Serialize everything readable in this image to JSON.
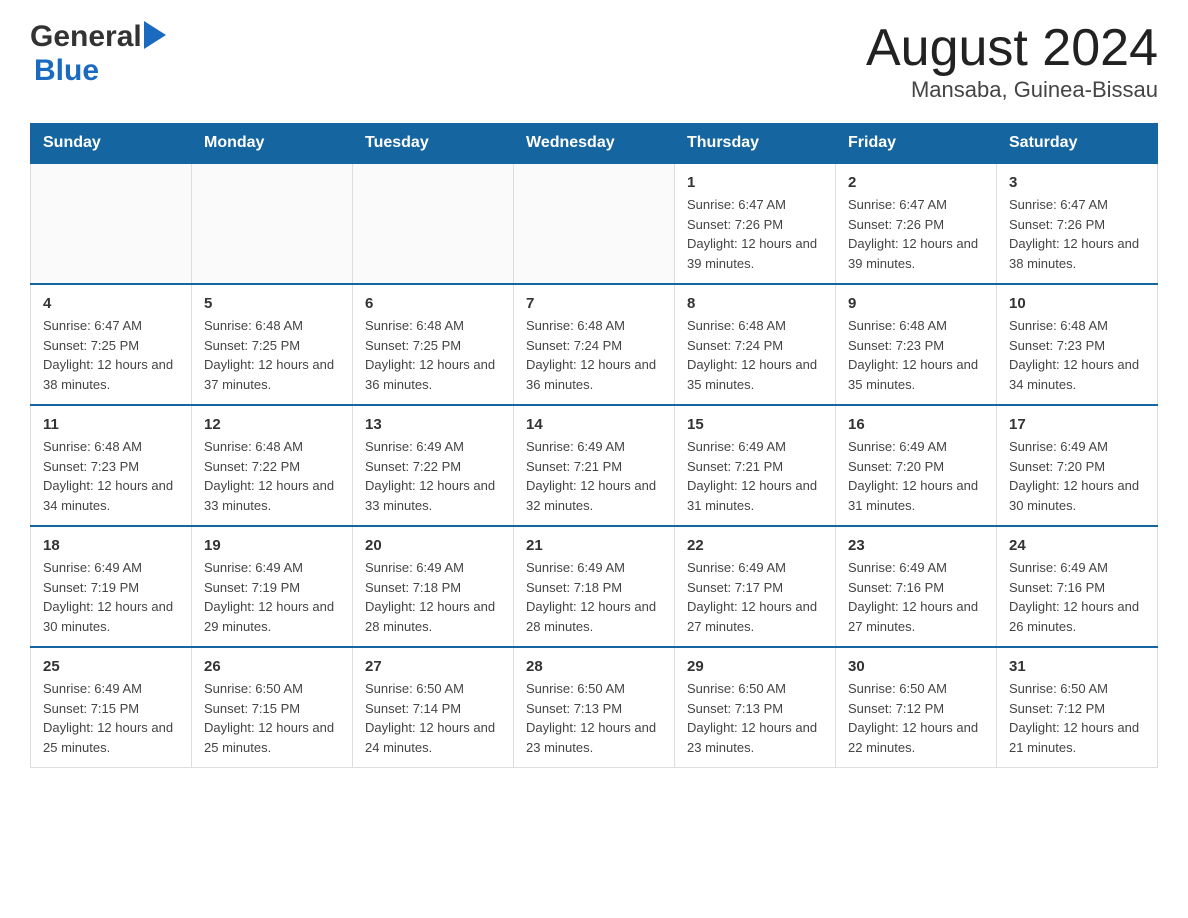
{
  "header": {
    "logo_general": "General",
    "logo_blue": "Blue",
    "title": "August 2024",
    "subtitle": "Mansaba, Guinea-Bissau"
  },
  "days_of_week": [
    "Sunday",
    "Monday",
    "Tuesday",
    "Wednesday",
    "Thursday",
    "Friday",
    "Saturday"
  ],
  "weeks": [
    [
      {
        "num": "",
        "sunrise": "",
        "sunset": "",
        "daylight": ""
      },
      {
        "num": "",
        "sunrise": "",
        "sunset": "",
        "daylight": ""
      },
      {
        "num": "",
        "sunrise": "",
        "sunset": "",
        "daylight": ""
      },
      {
        "num": "",
        "sunrise": "",
        "sunset": "",
        "daylight": ""
      },
      {
        "num": "1",
        "sunrise": "Sunrise: 6:47 AM",
        "sunset": "Sunset: 7:26 PM",
        "daylight": "Daylight: 12 hours and 39 minutes."
      },
      {
        "num": "2",
        "sunrise": "Sunrise: 6:47 AM",
        "sunset": "Sunset: 7:26 PM",
        "daylight": "Daylight: 12 hours and 39 minutes."
      },
      {
        "num": "3",
        "sunrise": "Sunrise: 6:47 AM",
        "sunset": "Sunset: 7:26 PM",
        "daylight": "Daylight: 12 hours and 38 minutes."
      }
    ],
    [
      {
        "num": "4",
        "sunrise": "Sunrise: 6:47 AM",
        "sunset": "Sunset: 7:25 PM",
        "daylight": "Daylight: 12 hours and 38 minutes."
      },
      {
        "num": "5",
        "sunrise": "Sunrise: 6:48 AM",
        "sunset": "Sunset: 7:25 PM",
        "daylight": "Daylight: 12 hours and 37 minutes."
      },
      {
        "num": "6",
        "sunrise": "Sunrise: 6:48 AM",
        "sunset": "Sunset: 7:25 PM",
        "daylight": "Daylight: 12 hours and 36 minutes."
      },
      {
        "num": "7",
        "sunrise": "Sunrise: 6:48 AM",
        "sunset": "Sunset: 7:24 PM",
        "daylight": "Daylight: 12 hours and 36 minutes."
      },
      {
        "num": "8",
        "sunrise": "Sunrise: 6:48 AM",
        "sunset": "Sunset: 7:24 PM",
        "daylight": "Daylight: 12 hours and 35 minutes."
      },
      {
        "num": "9",
        "sunrise": "Sunrise: 6:48 AM",
        "sunset": "Sunset: 7:23 PM",
        "daylight": "Daylight: 12 hours and 35 minutes."
      },
      {
        "num": "10",
        "sunrise": "Sunrise: 6:48 AM",
        "sunset": "Sunset: 7:23 PM",
        "daylight": "Daylight: 12 hours and 34 minutes."
      }
    ],
    [
      {
        "num": "11",
        "sunrise": "Sunrise: 6:48 AM",
        "sunset": "Sunset: 7:23 PM",
        "daylight": "Daylight: 12 hours and 34 minutes."
      },
      {
        "num": "12",
        "sunrise": "Sunrise: 6:48 AM",
        "sunset": "Sunset: 7:22 PM",
        "daylight": "Daylight: 12 hours and 33 minutes."
      },
      {
        "num": "13",
        "sunrise": "Sunrise: 6:49 AM",
        "sunset": "Sunset: 7:22 PM",
        "daylight": "Daylight: 12 hours and 33 minutes."
      },
      {
        "num": "14",
        "sunrise": "Sunrise: 6:49 AM",
        "sunset": "Sunset: 7:21 PM",
        "daylight": "Daylight: 12 hours and 32 minutes."
      },
      {
        "num": "15",
        "sunrise": "Sunrise: 6:49 AM",
        "sunset": "Sunset: 7:21 PM",
        "daylight": "Daylight: 12 hours and 31 minutes."
      },
      {
        "num": "16",
        "sunrise": "Sunrise: 6:49 AM",
        "sunset": "Sunset: 7:20 PM",
        "daylight": "Daylight: 12 hours and 31 minutes."
      },
      {
        "num": "17",
        "sunrise": "Sunrise: 6:49 AM",
        "sunset": "Sunset: 7:20 PM",
        "daylight": "Daylight: 12 hours and 30 minutes."
      }
    ],
    [
      {
        "num": "18",
        "sunrise": "Sunrise: 6:49 AM",
        "sunset": "Sunset: 7:19 PM",
        "daylight": "Daylight: 12 hours and 30 minutes."
      },
      {
        "num": "19",
        "sunrise": "Sunrise: 6:49 AM",
        "sunset": "Sunset: 7:19 PM",
        "daylight": "Daylight: 12 hours and 29 minutes."
      },
      {
        "num": "20",
        "sunrise": "Sunrise: 6:49 AM",
        "sunset": "Sunset: 7:18 PM",
        "daylight": "Daylight: 12 hours and 28 minutes."
      },
      {
        "num": "21",
        "sunrise": "Sunrise: 6:49 AM",
        "sunset": "Sunset: 7:18 PM",
        "daylight": "Daylight: 12 hours and 28 minutes."
      },
      {
        "num": "22",
        "sunrise": "Sunrise: 6:49 AM",
        "sunset": "Sunset: 7:17 PM",
        "daylight": "Daylight: 12 hours and 27 minutes."
      },
      {
        "num": "23",
        "sunrise": "Sunrise: 6:49 AM",
        "sunset": "Sunset: 7:16 PM",
        "daylight": "Daylight: 12 hours and 27 minutes."
      },
      {
        "num": "24",
        "sunrise": "Sunrise: 6:49 AM",
        "sunset": "Sunset: 7:16 PM",
        "daylight": "Daylight: 12 hours and 26 minutes."
      }
    ],
    [
      {
        "num": "25",
        "sunrise": "Sunrise: 6:49 AM",
        "sunset": "Sunset: 7:15 PM",
        "daylight": "Daylight: 12 hours and 25 minutes."
      },
      {
        "num": "26",
        "sunrise": "Sunrise: 6:50 AM",
        "sunset": "Sunset: 7:15 PM",
        "daylight": "Daylight: 12 hours and 25 minutes."
      },
      {
        "num": "27",
        "sunrise": "Sunrise: 6:50 AM",
        "sunset": "Sunset: 7:14 PM",
        "daylight": "Daylight: 12 hours and 24 minutes."
      },
      {
        "num": "28",
        "sunrise": "Sunrise: 6:50 AM",
        "sunset": "Sunset: 7:13 PM",
        "daylight": "Daylight: 12 hours and 23 minutes."
      },
      {
        "num": "29",
        "sunrise": "Sunrise: 6:50 AM",
        "sunset": "Sunset: 7:13 PM",
        "daylight": "Daylight: 12 hours and 23 minutes."
      },
      {
        "num": "30",
        "sunrise": "Sunrise: 6:50 AM",
        "sunset": "Sunset: 7:12 PM",
        "daylight": "Daylight: 12 hours and 22 minutes."
      },
      {
        "num": "31",
        "sunrise": "Sunrise: 6:50 AM",
        "sunset": "Sunset: 7:12 PM",
        "daylight": "Daylight: 12 hours and 21 minutes."
      }
    ]
  ]
}
